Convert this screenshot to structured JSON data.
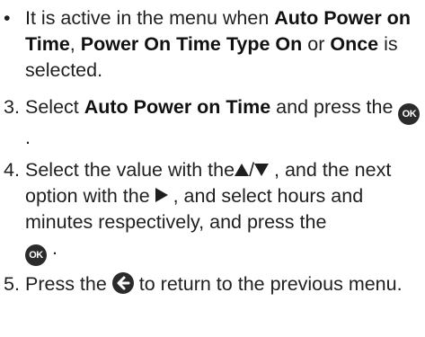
{
  "bullet": {
    "mark": "•",
    "prefix": "It is active in the menu when ",
    "item1": "Auto Power on Time",
    "sep1": ", ",
    "item2": "Power On Time Type On",
    "sep2": " or ",
    "item3": "Once",
    "suffix": " is selected."
  },
  "steps": [
    {
      "number": "3.",
      "prefix": "Select ",
      "bold": "Auto Power on Time",
      "middle": " and press the ",
      "icon": "ok-button-icon",
      "suffix": "."
    },
    {
      "number": "4.",
      "part1": "Select the value with the",
      "icon_updown": "up-down-arrows-icon",
      "part2": " , and the next option with the ",
      "icon_right": "right-arrow-icon",
      "part3": " , and select hours and minutes respectively, and press the ",
      "icon_ok": "ok-button-icon",
      "suffix": " ."
    },
    {
      "number": "5.",
      "prefix": "Press the ",
      "icon": "back-button-icon",
      "suffix": " to return to the previous menu."
    }
  ],
  "icons": {
    "ok_label": "OK",
    "slash": "/"
  },
  "colors": {
    "text": "#1f1f1f",
    "icon_fill": "#2b2b2b"
  }
}
